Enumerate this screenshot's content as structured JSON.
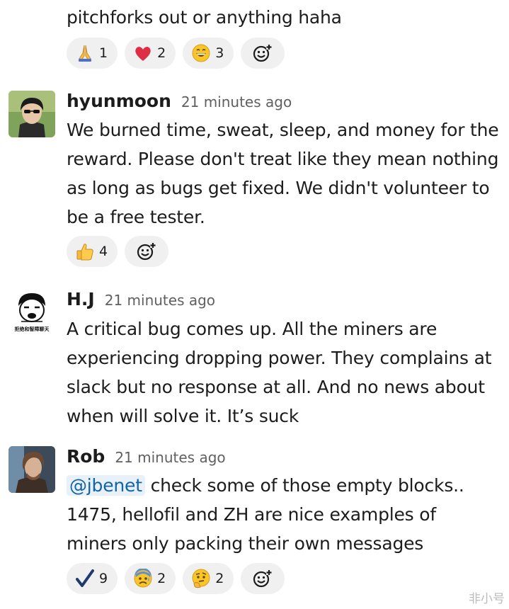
{
  "top_message": {
    "text": "pitchforks out or anything haha",
    "reactions": [
      {
        "icon": "praying-hands-emoji",
        "count": "1"
      },
      {
        "icon": "red-heart-emoji",
        "count": "2"
      },
      {
        "icon": "grinning-face-emoji",
        "count": "3"
      }
    ]
  },
  "messages": [
    {
      "author": "hyunmoon",
      "time": "21 minutes ago",
      "lines": [
        "We burned time, sweat, sleep, and money for the",
        "reward. Please don't treat like they mean nothing",
        "as long as bugs get fixed. We didn't volunteer to",
        "be a free tester."
      ],
      "reactions": [
        {
          "icon": "thumbs-up-emoji",
          "count": "4"
        }
      ]
    },
    {
      "author": "H.J",
      "time": "21 minutes ago",
      "avatar_caption": "拒绝和智障聊天",
      "lines": [
        "A critical bug comes up. All the miners are",
        "experiencing dropping power. They complains at",
        "slack but no response at all. And no news about",
        "when will solve it. It’s suck"
      ]
    },
    {
      "author": "Rob",
      "time": "21 minutes ago",
      "mention": "@jbenet",
      "lines": [
        " check some of those empty blocks..",
        "1475, hellofil and ZH are nice examples of",
        "miners only packing their own messages"
      ],
      "reactions": [
        {
          "icon": "check-mark-emoji",
          "count": "9"
        },
        {
          "icon": "anxious-face-emoji",
          "count": "2"
        },
        {
          "icon": "thinking-face-emoji",
          "count": "2"
        }
      ]
    }
  ],
  "watermark": "非小号"
}
